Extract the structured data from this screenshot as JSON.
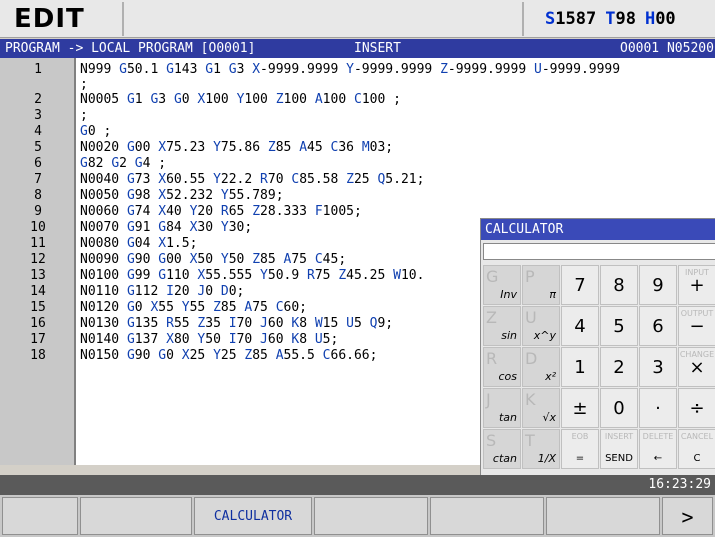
{
  "header": {
    "mode": "EDIT",
    "status": [
      {
        "letter": "S",
        "value": "1587"
      },
      {
        "letter": "T",
        "value": "98"
      },
      {
        "letter": "H",
        "value": "00"
      }
    ]
  },
  "titlebar": {
    "path": "PROGRAM -> LOCAL PROGRAM [O0001]",
    "mode": "INSERT",
    "program_number": "O0001 N05200"
  },
  "program": {
    "lines": [
      {
        "num": "1",
        "code": "N999 G50.1 G143 G1 G3 X-9999.9999 Y-9999.9999 Z-9999.9999 U-9999.9999"
      },
      {
        "num": "",
        "code": "  ;"
      },
      {
        "num": "2",
        "code": "N0005 G1 G3 G0 X100 Y100 Z100 A100 C100 ;"
      },
      {
        "num": "3",
        "code": ";"
      },
      {
        "num": "4",
        "code": "G0 ;"
      },
      {
        "num": "5",
        "code": "N0020 G00 X75.23 Y75.86 Z85 A45 C36 M03;"
      },
      {
        "num": "6",
        "code": "G82 G2 G4 ;"
      },
      {
        "num": "7",
        "code": "N0040 G73 X60.55 Y22.2 R70 C85.58 Z25 Q5.21;"
      },
      {
        "num": "8",
        "code": "N0050 G98 X52.232 Y55.789;"
      },
      {
        "num": "9",
        "code": "N0060 G74 X40 Y20 R65 Z28.333 F1005;"
      },
      {
        "num": "10",
        "code": "N0070 G91 G84 X30 Y30;"
      },
      {
        "num": "11",
        "code": "N0080 G04 X1.5;"
      },
      {
        "num": "12",
        "code": "N0090 G90 G00 X50 Y50 Z85 A75 C45;"
      },
      {
        "num": "13",
        "code": "N0100 G99 G110 X55.555 Y50.9 R75 Z45.25 W10."
      },
      {
        "num": "14",
        "code": "N0110 G112 I20 J0 D0;"
      },
      {
        "num": "15",
        "code": "N0120 G0 X55 Y55 Z85 A75 C60;"
      },
      {
        "num": "16",
        "code": "N0130 G135 R55 Z35 I70 J60 K8 W15 U5 Q9;"
      },
      {
        "num": "17",
        "code": "N0140 G137 X80 Y50 I70 J60 K8 U5;"
      },
      {
        "num": "18",
        "code": "N0150 G90 G0 X25 Y25 Z85 A55.5 C66.66;"
      }
    ]
  },
  "calculator": {
    "title": "CALCULATOR",
    "display": "",
    "keys": [
      {
        "row": 0,
        "col": 0,
        "shade": "G",
        "main": "",
        "sub": "Inv",
        "name": "inv-key"
      },
      {
        "row": 0,
        "col": 1,
        "shade": "P",
        "main": "",
        "sub": "π",
        "name": "pi-key"
      },
      {
        "row": 0,
        "col": 2,
        "shade": "",
        "main": "7",
        "sub": "",
        "name": "digit-7-key"
      },
      {
        "row": 0,
        "col": 3,
        "shade": "",
        "main": "8",
        "sub": "",
        "name": "digit-8-key"
      },
      {
        "row": 0,
        "col": 4,
        "shade": "",
        "main": "9",
        "sub": "",
        "name": "digit-9-key"
      },
      {
        "row": 0,
        "col": 5,
        "shade": "",
        "tiny": "INPUT",
        "main": "+",
        "sub": "",
        "name": "plus-key"
      },
      {
        "row": 1,
        "col": 0,
        "shade": "Z",
        "main": "",
        "sub": "sin",
        "name": "sin-key"
      },
      {
        "row": 1,
        "col": 1,
        "shade": "U",
        "main": "",
        "sub": "x^y",
        "name": "power-key"
      },
      {
        "row": 1,
        "col": 2,
        "shade": "",
        "main": "4",
        "sub": "",
        "name": "digit-4-key"
      },
      {
        "row": 1,
        "col": 3,
        "shade": "",
        "main": "5",
        "sub": "",
        "name": "digit-5-key"
      },
      {
        "row": 1,
        "col": 4,
        "shade": "",
        "main": "6",
        "sub": "",
        "name": "digit-6-key"
      },
      {
        "row": 1,
        "col": 5,
        "shade": "",
        "tiny": "OUTPUT",
        "main": "−",
        "sub": "",
        "name": "minus-key"
      },
      {
        "row": 2,
        "col": 0,
        "shade": "R",
        "main": "",
        "sub": "cos",
        "name": "cos-key"
      },
      {
        "row": 2,
        "col": 1,
        "shade": "D",
        "main": "",
        "sub": "x²",
        "name": "square-key"
      },
      {
        "row": 2,
        "col": 2,
        "shade": "",
        "main": "1",
        "sub": "",
        "name": "digit-1-key"
      },
      {
        "row": 2,
        "col": 3,
        "shade": "",
        "main": "2",
        "sub": "",
        "name": "digit-2-key"
      },
      {
        "row": 2,
        "col": 4,
        "shade": "",
        "main": "3",
        "sub": "",
        "name": "digit-3-key"
      },
      {
        "row": 2,
        "col": 5,
        "shade": "",
        "tiny": "CHANGE",
        "main": "×",
        "sub": "",
        "name": "multiply-key"
      },
      {
        "row": 3,
        "col": 0,
        "shade": "J",
        "main": "",
        "sub": "tan",
        "name": "tan-key"
      },
      {
        "row": 3,
        "col": 1,
        "shade": "K",
        "main": "",
        "sub": "√x",
        "name": "sqrt-key"
      },
      {
        "row": 3,
        "col": 2,
        "shade": "",
        "main": "±",
        "sub": "",
        "name": "sign-key"
      },
      {
        "row": 3,
        "col": 3,
        "shade": "",
        "main": "0",
        "sub": "",
        "name": "digit-0-key"
      },
      {
        "row": 3,
        "col": 4,
        "shade": "",
        "main": "·",
        "sub": "",
        "name": "decimal-key"
      },
      {
        "row": 3,
        "col": 5,
        "shade": "",
        "main": "÷",
        "sub": "",
        "name": "divide-key"
      },
      {
        "row": 4,
        "col": 0,
        "shade": "S",
        "main": "",
        "sub": "ctan",
        "name": "ctan-key"
      },
      {
        "row": 4,
        "col": 1,
        "shade": "T",
        "main": "",
        "sub": "1/X",
        "name": "reciprocal-key"
      },
      {
        "row": 4,
        "col": 2,
        "shade": "",
        "tiny": "EOB",
        "small": "=",
        "main": "",
        "sub": "",
        "name": "equals-key"
      },
      {
        "row": 4,
        "col": 3,
        "shade": "",
        "tiny": "INSERT",
        "small": "SEND",
        "main": "",
        "sub": "",
        "name": "send-key"
      },
      {
        "row": 4,
        "col": 4,
        "shade": "",
        "tiny": "DELETE",
        "small": "←",
        "main": "",
        "sub": "",
        "name": "backspace-key"
      },
      {
        "row": 4,
        "col": 5,
        "shade": "",
        "tiny": "CANCEL",
        "small": "C",
        "main": "",
        "sub": "",
        "name": "clear-key"
      }
    ]
  },
  "statusline": {
    "time": "16:23:29"
  },
  "softkeys": [
    "",
    "",
    "CALCULATOR",
    "",
    "",
    "",
    ">"
  ]
}
